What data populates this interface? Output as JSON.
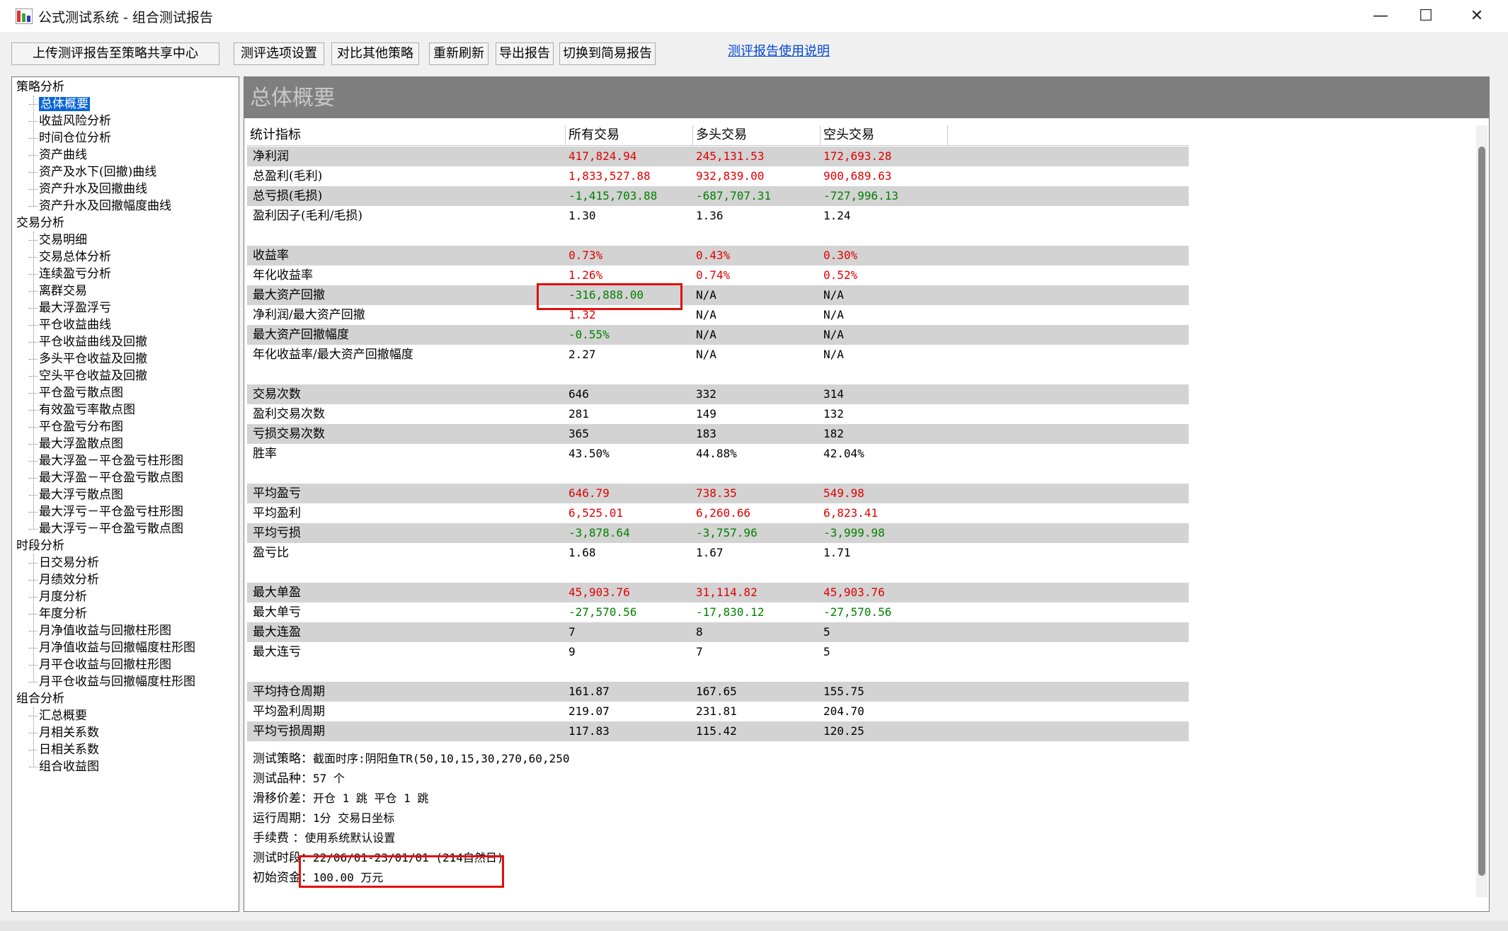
{
  "window": {
    "title": "公式测试系统 - 组合测试报告"
  },
  "toolbar": {
    "upload": "上传测评报告至策略共享中心",
    "options": "测评选项设置",
    "compare": "对比其他策略",
    "refresh": "重新刷新",
    "export": "导出报告",
    "switch": "切换到简易报告",
    "help": "测评报告使用说明"
  },
  "tree": {
    "groups": [
      {
        "label": "策略分析",
        "items": [
          "总体概要",
          "收益风险分析",
          "时间仓位分析",
          "资产曲线",
          "资产及水下(回撤)曲线",
          "资产升水及回撤曲线",
          "资产升水及回撤幅度曲线"
        ]
      },
      {
        "label": "交易分析",
        "items": [
          "交易明细",
          "交易总体分析",
          "连续盈亏分析",
          "离群交易",
          "最大浮盈浮亏",
          "平仓收益曲线",
          "平仓收益曲线及回撤",
          "多头平仓收益及回撤",
          "空头平仓收益及回撤",
          "平仓盈亏散点图",
          "有效盈亏率散点图",
          "平仓盈亏分布图",
          "最大浮盈散点图",
          "最大浮盈－平仓盈亏柱形图",
          "最大浮盈－平仓盈亏散点图",
          "最大浮亏散点图",
          "最大浮亏－平仓盈亏柱形图",
          "最大浮亏－平仓盈亏散点图"
        ]
      },
      {
        "label": "时段分析",
        "items": [
          "日交易分析",
          "月绩效分析",
          "月度分析",
          "年度分析",
          "月净值收益与回撤柱形图",
          "月净值收益与回撤幅度柱形图",
          "月平仓收益与回撤柱形图",
          "月平仓收益与回撤幅度柱形图"
        ]
      },
      {
        "label": "组合分析",
        "items": [
          "汇总概要",
          "月相关系数",
          "日相关系数",
          "组合收益图"
        ]
      }
    ]
  },
  "main": {
    "title": "总体概要",
    "columns": [
      "统计指标",
      "所有交易",
      "多头交易",
      "空头交易"
    ],
    "rows": [
      [
        "净利润",
        "417,824.94",
        "245,131.53",
        "172,693.28"
      ],
      [
        "总盈利(毛利)",
        "1,833,527.88",
        "932,839.00",
        "900,689.63"
      ],
      [
        "总亏损(毛损)",
        "-1,415,703.88",
        "-687,707.31",
        "-727,996.13"
      ],
      [
        "盈利因子(毛利/毛损)",
        "1.30",
        "1.36",
        "1.24"
      ],
      [
        "收益率",
        "0.73%",
        "0.43%",
        "0.30%"
      ],
      [
        "年化收益率",
        "1.26%",
        "0.74%",
        "0.52%"
      ],
      [
        "最大资产回撤",
        "-316,888.00",
        "N/A",
        "N/A"
      ],
      [
        "净利润/最大资产回撤",
        "1.32",
        "N/A",
        "N/A"
      ],
      [
        "最大资产回撤幅度",
        "-0.55%",
        "N/A",
        "N/A"
      ],
      [
        "年化收益率/最大资产回撤幅度",
        "2.27",
        "N/A",
        "N/A"
      ],
      [
        "交易次数",
        "646",
        "332",
        "314"
      ],
      [
        "盈利交易次数",
        "281",
        "149",
        "132"
      ],
      [
        "亏损交易次数",
        "365",
        "183",
        "182"
      ],
      [
        "胜率",
        "43.50%",
        "44.88%",
        "42.04%"
      ],
      [
        "平均盈亏",
        "646.79",
        "738.35",
        "549.98"
      ],
      [
        "平均盈利",
        "6,525.01",
        "6,260.66",
        "6,823.41"
      ],
      [
        "平均亏损",
        "-3,878.64",
        "-3,757.96",
        "-3,999.98"
      ],
      [
        "盈亏比",
        "1.68",
        "1.67",
        "1.71"
      ],
      [
        "最大单盈",
        "45,903.76",
        "31,114.82",
        "45,903.76"
      ],
      [
        "最大单亏",
        "-27,570.56",
        "-17,830.12",
        "-27,570.56"
      ],
      [
        "最大连盈",
        "7",
        "8",
        "5"
      ],
      [
        "最大连亏",
        "9",
        "7",
        "5"
      ],
      [
        "平均持仓周期",
        "161.87",
        "167.65",
        "155.75"
      ],
      [
        "平均盈利周期",
        "219.07",
        "231.81",
        "204.70"
      ],
      [
        "平均亏损周期",
        "117.83",
        "115.42",
        "120.25"
      ]
    ],
    "info": [
      [
        "测试策略：",
        "截面时序:阴阳鱼TR(50,10,15,30,270,60,250"
      ],
      [
        "测试品种：",
        "57 个"
      ],
      [
        "滑移价差：",
        "开仓 1 跳  平仓 1 跳"
      ],
      [
        "运行周期：",
        "1分 交易日坐标"
      ],
      [
        "手续费  ：",
        "使用系统默认设置"
      ],
      [
        "测试时段：",
        "22/06/01-23/01/01 (214自然日)"
      ],
      [
        "初始资金：",
        "100.00 万元"
      ]
    ]
  },
  "colors": {
    "positive": "#e00000",
    "negative": "#008000",
    "selection": "#0a64d8",
    "highlight": "#e01010"
  }
}
